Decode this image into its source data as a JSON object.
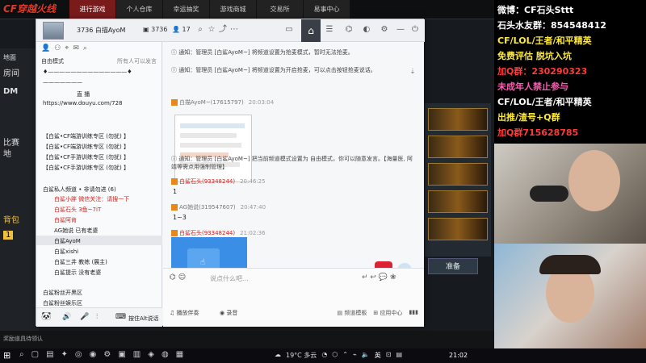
{
  "game": {
    "logo": "CF穿越火线",
    "nav": [
      "进行游戏",
      "个人仓库",
      "幸运抽奖",
      "游戏商城",
      "交易所",
      "易事中心"
    ],
    "left_labels": [
      "地面",
      "房间",
      "DM",
      "比赛",
      "地",
      "背包",
      "1"
    ],
    "ready_button": "准备",
    "bottom_text": "奖励道具待领认"
  },
  "chat": {
    "channel_title": "3736 白描AyoM",
    "channel_id": "3736",
    "member_count": "17",
    "header_icons": [
      "video-icon",
      "home-icon",
      "document-icon",
      "gamepad-icon",
      "toggle-icon",
      "settings-icon",
      "minimize-icon",
      "power-icon"
    ],
    "panel": {
      "mode": "自由模式",
      "online": "所有人可以发言",
      "rows": [
        {
          "text": "♦——————————————♦",
          "style": "normal"
        },
        {
          "text": "———————",
          "style": "normal"
        },
        {
          "text": "直  播",
          "style": "normal"
        },
        {
          "text": "https://www.douyu.com/728",
          "style": "normal"
        },
        {
          "text": "【白鲨•CF端游训练专区  (勿扰) 】",
          "style": "normal"
        },
        {
          "text": "【白鲨•CF端游训练专区  (勿扰) 】",
          "style": "normal"
        },
        {
          "text": "【白鲨•CF手游训练专区  (勿扰) 】",
          "style": "normal"
        },
        {
          "text": "【白鲨•CF手游训练专区  (勿扰) 】",
          "style": "normal"
        },
        {
          "text": "白鲨私人频道 • 非请勿进 (6)",
          "style": "normal"
        },
        {
          "text": "白鲨小胖  微信关注：请搜一下",
          "style": "red"
        },
        {
          "text": "白鲨石头  3鱼~7iT",
          "style": "red"
        },
        {
          "text": "白鲨阿肯",
          "style": "red"
        },
        {
          "text": "AG她说  已有老婆",
          "style": "normal"
        },
        {
          "text": "白鲨AyoM",
          "style": "normal"
        },
        {
          "text": "白鲨xishi",
          "style": "normal"
        },
        {
          "text": "白鲨三井  教练 (展主)",
          "style": "normal"
        },
        {
          "text": "白鲨提示  没有老婆",
          "style": "normal"
        },
        {
          "text": "白鲨粉丝开黑区",
          "style": "normal"
        },
        {
          "text": "白鲨粉丝娱乐区",
          "style": "normal"
        }
      ]
    },
    "panel_bottom": {
      "mic_mode": "按住Alt说话",
      "accompany": "播放伴奏",
      "record": "录音"
    },
    "messages": [
      {
        "type": "notice",
        "text": "通知：管理员 [白鲨AyoM~] 将频道设置为抢麦模式，暂时无法抢麦。"
      },
      {
        "type": "notice",
        "text": "通知：管理员 [白鲨AyoM~] 将频道设置为开启抢麦，可以点击按钮抢麦说话。"
      },
      {
        "type": "sender",
        "name": "白描AyoM~(17615797)",
        "time": "20:03:04",
        "color": "gray"
      },
      {
        "type": "notice",
        "text": "通知：管理员 [白鲨AyoM~] 把当前频道模式设置为 自由模式，你可以随意发言。【海量医, 阿靖等需点用强制管理】"
      },
      {
        "type": "sender",
        "name": "白鲨石头(93348244)",
        "time": "20:46:25",
        "color": "red"
      },
      {
        "type": "text",
        "text": "1"
      },
      {
        "type": "sender",
        "name": "AG她说(319547607)",
        "time": "20:47:40",
        "color": "gray"
      },
      {
        "type": "text",
        "text": "1~3"
      },
      {
        "type": "sender",
        "name": "白鲨石头(93348244)",
        "time": "21:02:36",
        "color": "red"
      }
    ],
    "composer": {
      "placeholder": "说点什么吧...",
      "channel_template": "频道模板",
      "app_center": "应用中心"
    }
  },
  "overlay": {
    "lines": [
      {
        "text": "微博：CF石头Sttt",
        "color": "white"
      },
      {
        "text": "石头水友群：854548412",
        "color": "white"
      },
      {
        "text": "CF/LOL/王者/和平精英",
        "color": "yellow"
      },
      {
        "text": "免费评估  脱坑入坑",
        "color": "yellow"
      },
      {
        "text": "加Q群：230290323",
        "color": "red"
      },
      {
        "text": "未成年人禁止参与",
        "color": "pink"
      },
      {
        "text": "CF/LOL/王者/和平精英",
        "color": "white"
      },
      {
        "text": "出推/渣号+Q群",
        "color": "yellow"
      },
      {
        "text": "加Q群715628785",
        "color": "red"
      }
    ]
  },
  "taskbar": {
    "weather": "19°C 多云",
    "lang": "英",
    "clock": "21:02"
  },
  "colors": {
    "accent_red": "#d4201b",
    "link_blue": "#3b7dd8",
    "header_dark": "#3a3f47"
  }
}
